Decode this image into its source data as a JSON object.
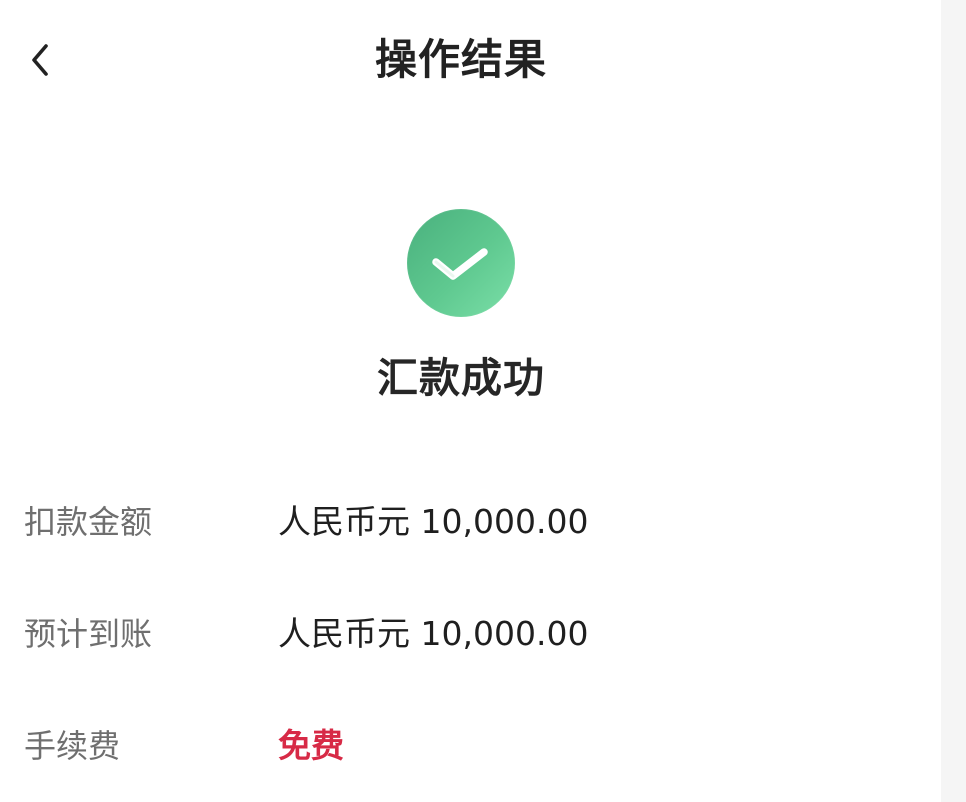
{
  "header": {
    "back_icon": "chevron-left-icon",
    "title": "操作结果"
  },
  "result": {
    "icon": "checkmark-circle-icon",
    "title": "汇款成功"
  },
  "details": {
    "deduction": {
      "label": "扣款金额",
      "value": "人民币元 10,000.00"
    },
    "arrival": {
      "label": "预计到账",
      "value": "人民币元 10,000.00"
    },
    "fee": {
      "label": "手续费",
      "value": "免费"
    }
  },
  "colors": {
    "success": "#5ec58f",
    "fee_accent": "#d72a46"
  }
}
